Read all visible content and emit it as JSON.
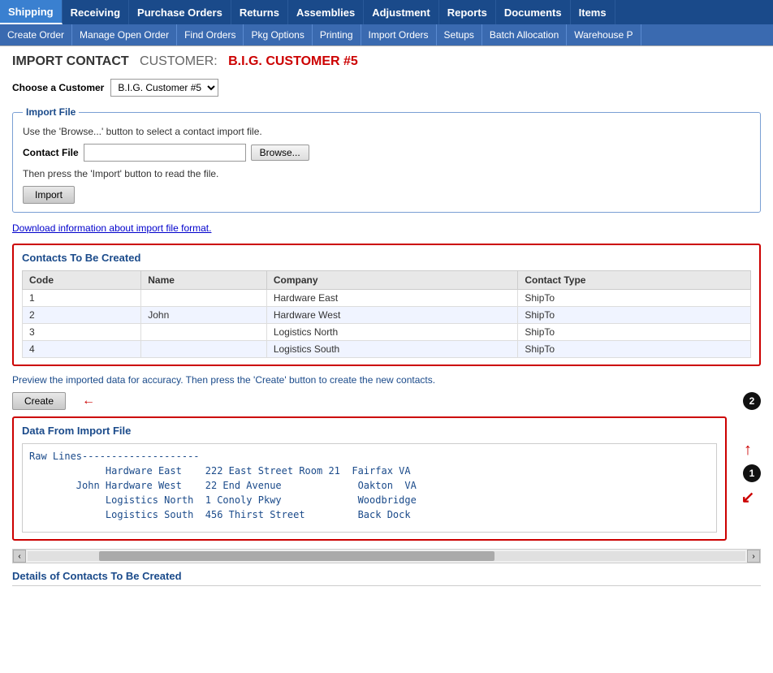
{
  "topNav": {
    "items": [
      {
        "label": "Shipping",
        "active": true
      },
      {
        "label": "Receiving",
        "active": false
      },
      {
        "label": "Purchase Orders",
        "active": false
      },
      {
        "label": "Returns",
        "active": false
      },
      {
        "label": "Assemblies",
        "active": false
      },
      {
        "label": "Adjustment",
        "active": false
      },
      {
        "label": "Reports",
        "active": false
      },
      {
        "label": "Documents",
        "active": false
      },
      {
        "label": "Items",
        "active": false
      }
    ]
  },
  "subNav": {
    "items": [
      {
        "label": "Create Order"
      },
      {
        "label": "Manage Open Order"
      },
      {
        "label": "Find Orders"
      },
      {
        "label": "Pkg Options"
      },
      {
        "label": "Printing"
      },
      {
        "label": "Import Orders"
      },
      {
        "label": "Setups"
      },
      {
        "label": "Batch Allocation"
      },
      {
        "label": "Warehouse P"
      }
    ]
  },
  "pageTitle": "Import Contact",
  "customerLabel": "Customer:",
  "customerName": "B.I.G. Customer #5",
  "chooseCustomerLabel": "Choose a Customer",
  "customerSelectValue": "B.I.G. Customer #5",
  "importFile": {
    "sectionTitle": "Import File",
    "instruction": "Use the 'Browse...' button to select a contact import file.",
    "contactFileLabel": "Contact File",
    "browseButton": "Browse...",
    "importNote": "Then press the 'Import' button to read the file.",
    "importButton": "Import",
    "downloadLink": "Download information about import file format."
  },
  "contactsSection": {
    "title": "Contacts To Be Created",
    "columns": [
      "Code",
      "Name",
      "Company",
      "Contact Type"
    ],
    "rows": [
      {
        "code": "1",
        "name": "",
        "company": "Hardware East",
        "contactType": "ShipTo"
      },
      {
        "code": "2",
        "name": "John",
        "company": "Hardware West",
        "contactType": "ShipTo"
      },
      {
        "code": "3",
        "name": "",
        "company": "Logistics North",
        "contactType": "ShipTo"
      },
      {
        "code": "4",
        "name": "",
        "company": "Logistics South",
        "contactType": "ShipTo"
      }
    ]
  },
  "previewText": "Preview the imported data for accuracy. Then press the 'Create' button to create the new contacts.",
  "createButton": "Create",
  "dataFromImportFile": {
    "title": "Data From Import File",
    "rawContent": "Raw Lines--------------------\n             Hardware East    222 East Street Room 21  Fairfax VA\n        John Hardware West    22 End Avenue             Oakton  VA\n             Logistics North  1 Conoly Pkwy             Woodbridge\n             Logistics South  456 Thirst Street         Back Dock"
  },
  "scrollBar": {
    "leftArrow": "‹",
    "rightArrow": "›"
  },
  "bottomSectionTitle": "Details of Contacts To Be Created",
  "annotations": {
    "circle1": "1",
    "circle2": "2"
  }
}
